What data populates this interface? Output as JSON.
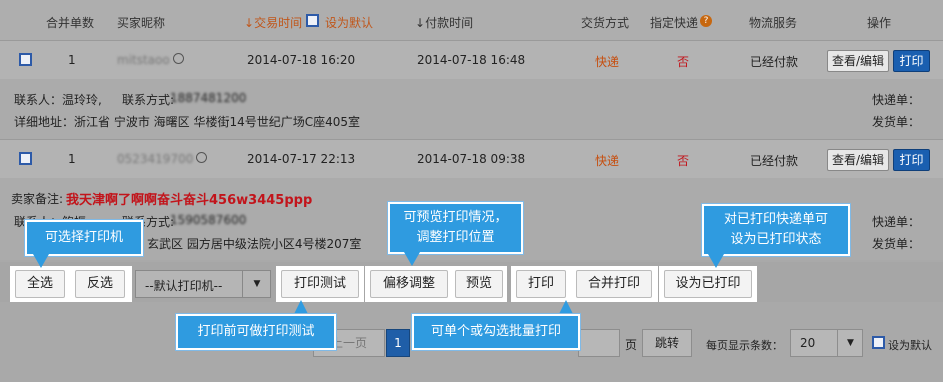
{
  "header": {
    "merge_count": "合并单数",
    "buyer": "买家昵称",
    "trade_time": "交易时间",
    "set_default": "设为默认",
    "pay_time": "付款时间",
    "delivery": "交货方式",
    "express": "指定快递",
    "logistics": "物流服务",
    "action": "操作"
  },
  "orders": [
    {
      "merge": "1",
      "buyer": "mitstaoo",
      "trade_time": "2014-07-18 16:20",
      "pay_time": "2014-07-18 16:48",
      "delivery": "快递",
      "express": "否",
      "logistics": "已经付款",
      "view_label": "查看/编辑",
      "print_label": "打印",
      "contact_label": "联系人：温玲玲,",
      "phone_label": "联系方式:",
      "phone_value": "1887481200",
      "address": "详细地址：浙江省 宁波市 海曙区 华楼街14号世纪广场C座405室",
      "express_no_label": "快递单：",
      "ship_no_label": "发货单："
    },
    {
      "merge": "1",
      "buyer": "0523419700",
      "trade_time": "2014-07-17 22:13",
      "pay_time": "2014-07-18 09:38",
      "delivery": "快递",
      "express": "否",
      "logistics": "已经付款",
      "view_label": "查看/编辑",
      "print_label": "打印",
      "seller_note_label": "卖家备注:",
      "seller_note_value": "我天津啊了啊啊奋斗奋斗456w3445ppp",
      "contact_label": "联系人：鲍振",
      "phone_label": "联系方式:",
      "phone_value": "1590587600",
      "address_tail": "玄武区 园方居中级法院小区4号楼207室",
      "express_no_label": "快递单：",
      "ship_no_label": "发货单："
    }
  ],
  "toolbar": {
    "select_all": "全选",
    "invert": "反选",
    "printer": "--默认打印机--",
    "print_test": "打印测试",
    "offset": "偏移调整",
    "preview": "预览",
    "print": "打印",
    "merge_print": "合并打印",
    "mark_printed": "设为已打印"
  },
  "pager": {
    "prev": "上一页",
    "current": "1",
    "page_unit": "页",
    "jump": "跳转",
    "per_page_label": "每页显示条数：",
    "per_page": "20",
    "set_default": "设为默认"
  },
  "callouts": {
    "choose_printer": "可选择打印机",
    "preview_tip": "可预览打印情况，\n调整打印位置",
    "mark_tip": "对已打印快递单可\n设为已打印状态",
    "test_tip": "打印前可做打印测试",
    "batch_tip": "可单个或勾选批量打印"
  },
  "colors": {
    "accent_blue": "#2f9be0",
    "print_button": "#1a5fb0",
    "delivery_orange": "#c64e0e",
    "express_red": "#c2141b"
  }
}
